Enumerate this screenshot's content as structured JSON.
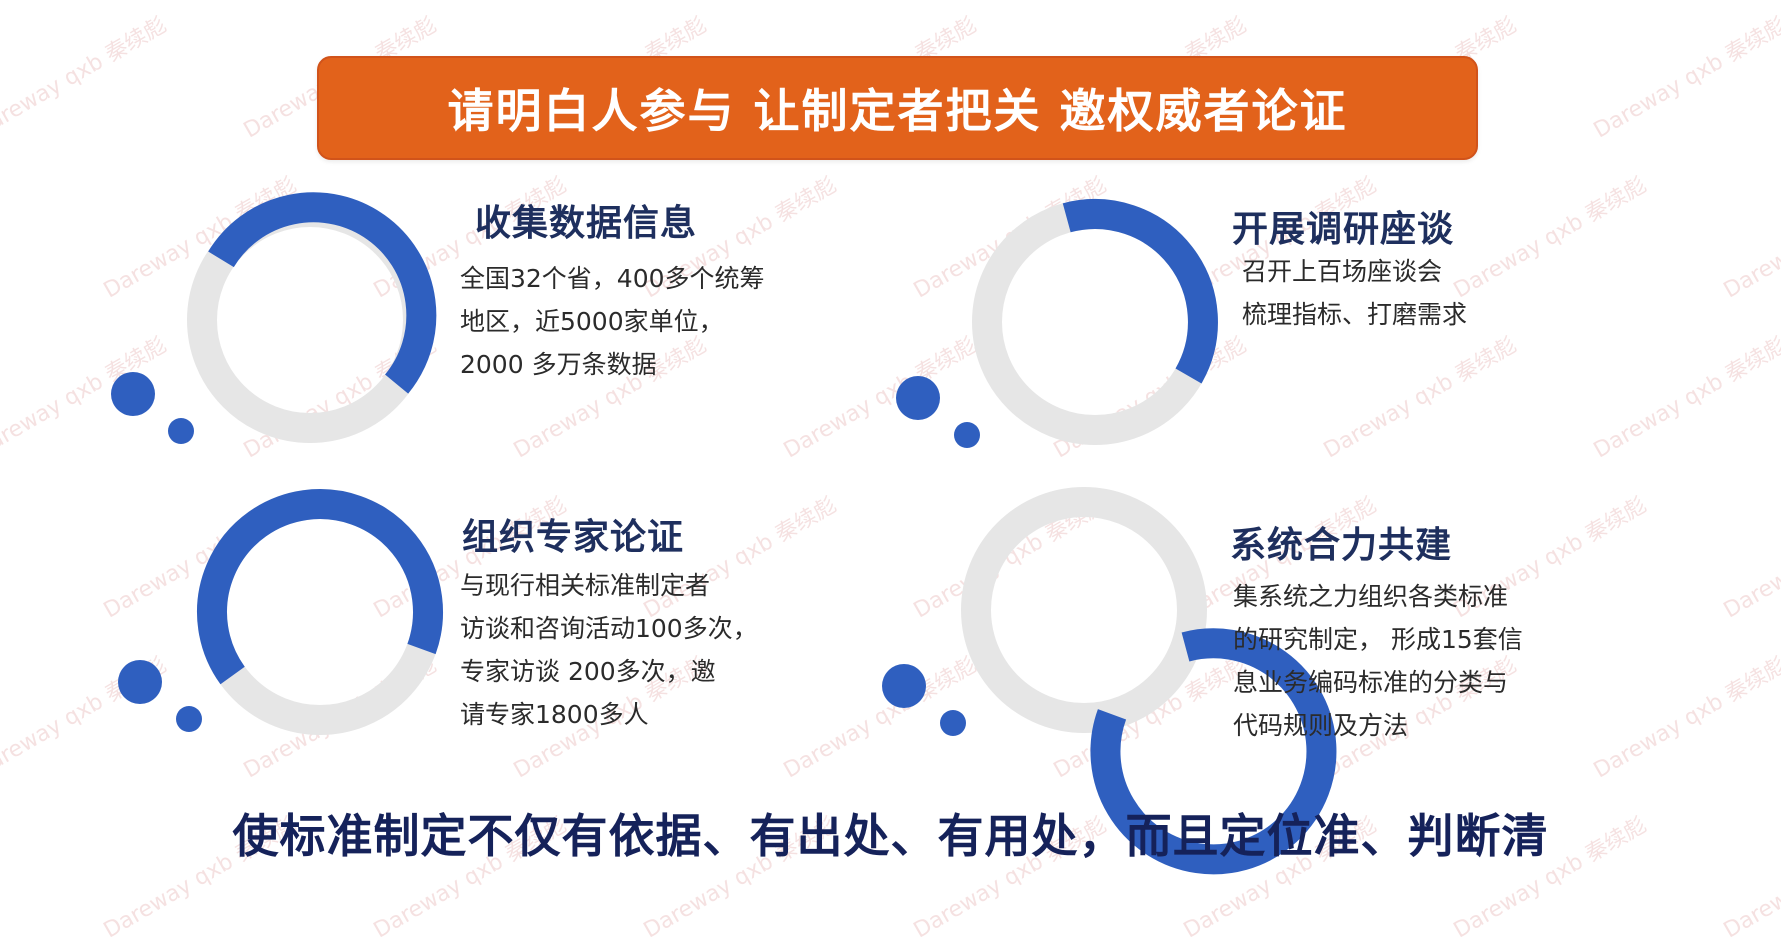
{
  "banner": {
    "title": "请明白人参与  让制定者把关  邀权威者论证",
    "color": "#e2621b"
  },
  "colors": {
    "ring_blue": "#2f5fbf",
    "ring_gray": "#e6e6e6",
    "heading": "#1e2f5e",
    "bottom_text": "#15225a"
  },
  "cards": [
    {
      "title": "收集数据信息",
      "lines": [
        "全国32个省，400多个统筹",
        "地区，近5000家单位，",
        "2000 多万条数据"
      ]
    },
    {
      "title": "开展调研座谈",
      "lines": [
        "召开上百场座谈会",
        "梳理指标、打磨需求"
      ]
    },
    {
      "title": "组织专家论证",
      "lines": [
        "与现行相关标准制定者",
        "访谈和咨询活动100多次，",
        "专家访谈 200多次，邀",
        "请专家1800多人"
      ]
    },
    {
      "title": "系统合力共建",
      "lines": [
        "集系统之力组织各类标准",
        "的研究制定， 形成15套信",
        "息业务编码标准的分类与",
        "代码规则及方法"
      ]
    }
  ],
  "bottom": {
    "text": "使标准制定不仅有依据、有出处、有用处，而且定位准、判断清"
  },
  "watermark": {
    "text": "Dareway qxb 秦续彪"
  }
}
